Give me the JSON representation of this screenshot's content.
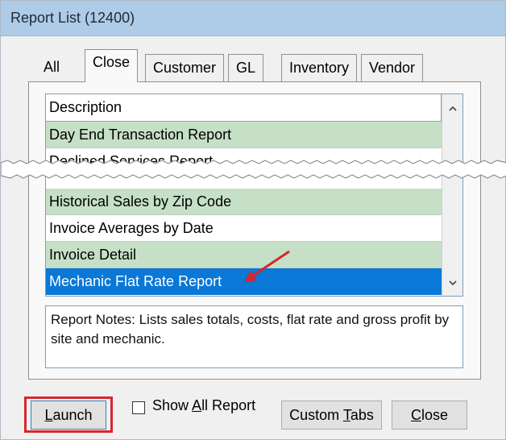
{
  "window": {
    "title": "Report List (12400)"
  },
  "tabs": [
    {
      "label": "All",
      "active": false
    },
    {
      "label": "Close",
      "active": true
    },
    {
      "label": "Customer",
      "active": false
    },
    {
      "label": "GL",
      "active": false
    },
    {
      "label": "Inventory",
      "active": false
    },
    {
      "label": "Vendor",
      "active": false
    }
  ],
  "list": {
    "header": "Description",
    "rows_top": [
      {
        "label": "Day End Transaction Report",
        "style": "green"
      },
      {
        "label": "Declined Services Report",
        "style": "white"
      }
    ],
    "rows_bottom": [
      {
        "label": "Historical Sales by Zip Code",
        "style": "green"
      },
      {
        "label": "Invoice Averages by Date",
        "style": "white"
      },
      {
        "label": "Invoice Detail",
        "style": "green"
      },
      {
        "label": "Mechanic Flat Rate Report",
        "style": "selected"
      }
    ]
  },
  "notes": {
    "text": "Report Notes:  Lists sales totals, costs, flat rate and gross profit by site and mechanic."
  },
  "buttons": {
    "launch_key": "L",
    "launch_rest": "aunch",
    "show_all_pre": "Show ",
    "show_all_key": "A",
    "show_all_rest": "ll Report",
    "custom_pre": "Custom ",
    "custom_key": "T",
    "custom_rest": "abs",
    "close_key": "C",
    "close_rest": "lose"
  },
  "colors": {
    "row_green": "#c5e0c7",
    "selected": "#0a78d7",
    "callout_red": "#d8262e"
  }
}
